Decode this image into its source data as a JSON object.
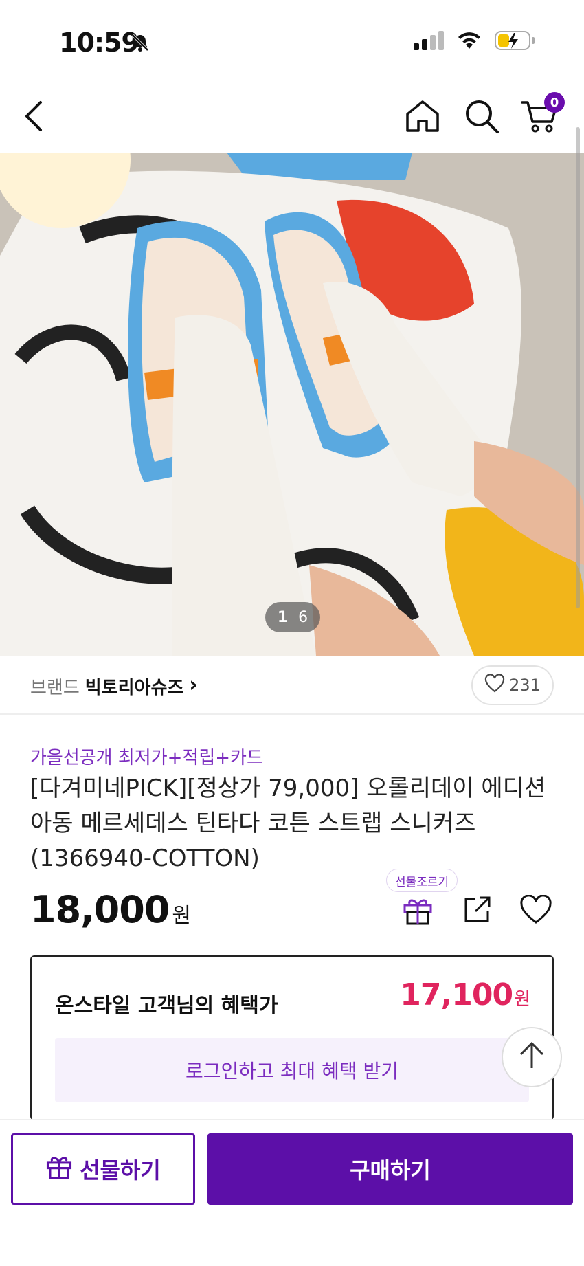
{
  "status_bar": {
    "time": "10:59",
    "icons": [
      "bell-slash-icon",
      "cellular-signal-icon",
      "wifi-icon",
      "battery-charging-icon"
    ]
  },
  "nav": {
    "icons": [
      "back-icon",
      "home-icon",
      "search-icon",
      "cart-icon"
    ],
    "cart_count": "0"
  },
  "gallery": {
    "current": "1",
    "total": "6"
  },
  "brand": {
    "label": "브랜드",
    "name": "빅토리아슈즈",
    "chevron": "›",
    "like_count": "231"
  },
  "product": {
    "promo": "가을선공개 최저가+적립+카드",
    "title": "[다겨미네PICK][정상가 79,000] 오롤리데이 에디션 아동 메르세데스 틴타다 코튼 스트랩 스니커즈 (1366940-COTTON)",
    "price": "18,000",
    "price_unit": "원",
    "gift_tooltip": "선물조르기",
    "action_icons": [
      "gift-icon",
      "share-icon",
      "heart-icon"
    ]
  },
  "benefit": {
    "label": "온스타일 고객님의 혜택가",
    "price": "17,100",
    "price_unit": "원",
    "login_cta": "로그인하고 최대 혜택 받기"
  },
  "bottom": {
    "gift_label": "선물하기",
    "buy_label": "구매하기"
  },
  "colors": {
    "brand_purple": "#5c0fa8",
    "accent_purple": "#7b2cbf",
    "sale_red": "#e0245e"
  }
}
